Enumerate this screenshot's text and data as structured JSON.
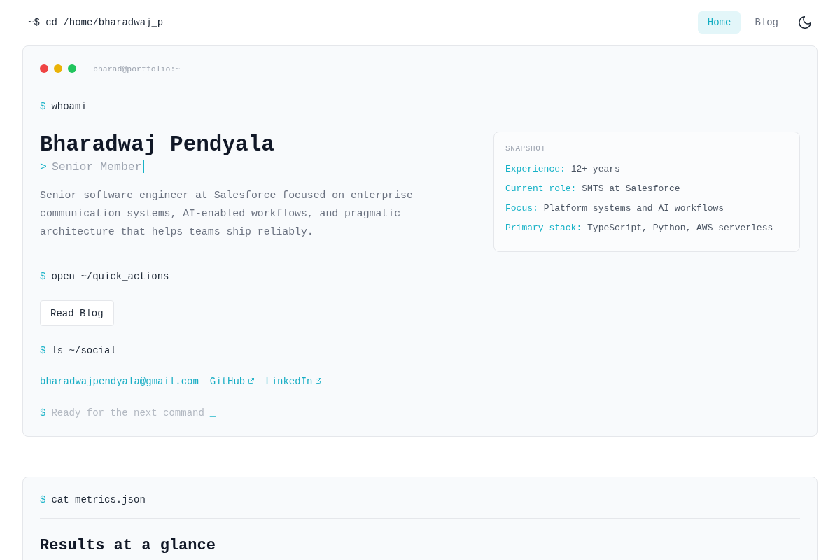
{
  "header": {
    "title": "~$ cd /home/bharadwaj_p",
    "nav": [
      {
        "label": "Home",
        "selected": true
      },
      {
        "label": "Blog",
        "selected": false
      }
    ]
  },
  "hero_terminal": {
    "window_dots": [
      {
        "color": "#ef4444"
      },
      {
        "color": "#eab308"
      },
      {
        "color": "#22c55e"
      }
    ],
    "window_title": "bharad@portfolio:~",
    "whoami": {
      "prompt": "$",
      "command": "whoami"
    },
    "name": "Bharadwaj Pendyala",
    "tagline": {
      "prompt": ">",
      "text": "Senior Member"
    },
    "bio": "Senior software engineer at Salesforce focused on enterprise communication systems, AI-enabled workflows, and pragmatic architecture that helps teams ship reliably.",
    "snapshot": {
      "heading": "SNAPSHOT",
      "rows": [
        {
          "label": "Experience:",
          "value": "12+ years"
        },
        {
          "label": "Current role:",
          "value": "SMTS at Salesforce"
        },
        {
          "label": "Focus:",
          "value": "Platform systems and AI workflows"
        },
        {
          "label": "Primary stack:",
          "value": "TypeScript, Python, AWS serverless"
        }
      ]
    },
    "quick_actions": {
      "prompt": "$",
      "command": "open ~/quick_actions",
      "buttons": [
        "Read Blog"
      ]
    },
    "social": {
      "prompt": "$",
      "command": "ls ~/social",
      "links": [
        {
          "label": "bharadwajpendyala@gmail.com",
          "external": false
        },
        {
          "label": "GitHub",
          "external": true
        },
        {
          "label": "LinkedIn",
          "external": true
        }
      ]
    },
    "idle_prompt": {
      "prompt": "$",
      "placeholder": "Ready for the next command",
      "cursor": "_"
    }
  },
  "metrics_terminal": {
    "prompt": "$",
    "command": "cat metrics.json",
    "heading": "Results at a glance"
  }
}
